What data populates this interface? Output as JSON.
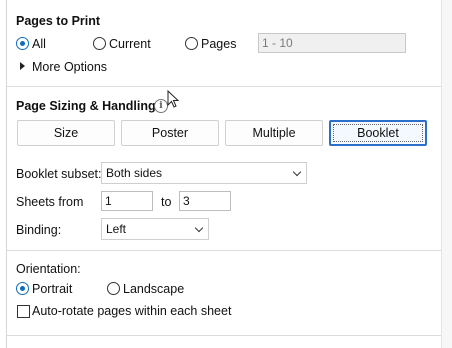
{
  "pages_to_print": {
    "heading": "Pages to Print",
    "options": [
      "All",
      "Current",
      "Pages"
    ],
    "selected": "All",
    "range_value": "1 - 10",
    "more_options": "More Options"
  },
  "sizing": {
    "heading": "Page Sizing & Handling",
    "info_icon": "info-icon",
    "buttons": [
      "Size",
      "Poster",
      "Multiple",
      "Booklet"
    ],
    "selected_button": "Booklet",
    "booklet_subset_label": "Booklet subset:",
    "booklet_subset_value": "Both sides",
    "sheets_from_label": "Sheets from",
    "sheets_from_value": "1",
    "to_label": "to",
    "sheets_to_value": "3",
    "binding_label": "Binding:",
    "binding_value": "Left"
  },
  "orientation": {
    "label": "Orientation:",
    "options": [
      "Portrait",
      "Landscape"
    ],
    "selected": "Portrait",
    "auto_rotate_label": "Auto-rotate pages within each sheet",
    "auto_rotate_checked": false
  },
  "colors": {
    "accent": "#0f6cbd",
    "selected_border": "#2b6fc9"
  }
}
